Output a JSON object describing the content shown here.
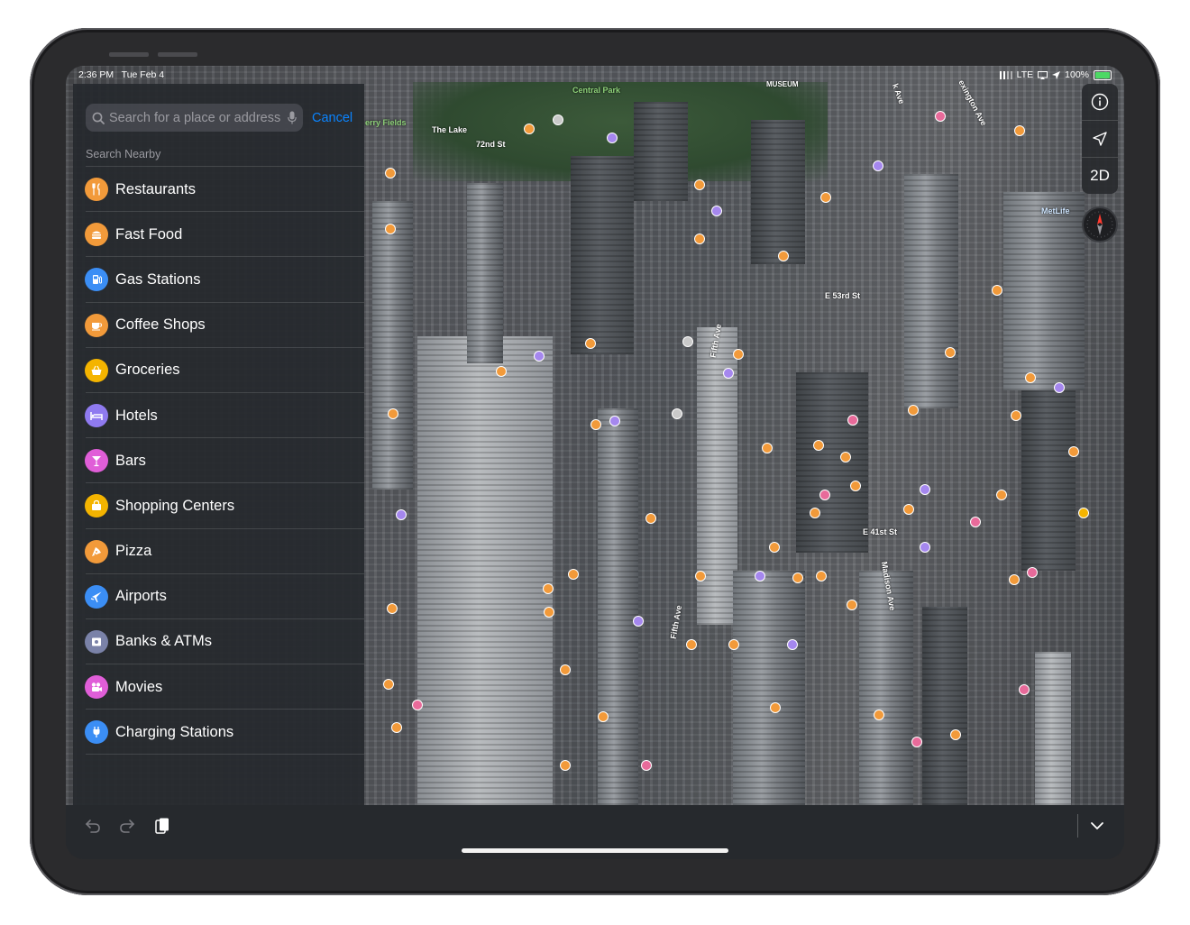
{
  "status_bar": {
    "time": "2:36 PM",
    "date": "Tue Feb 4",
    "network": "LTE",
    "battery": "100%"
  },
  "search": {
    "placeholder": "Search for a place or address",
    "cancel_label": "Cancel",
    "section_title": "Search Nearby"
  },
  "categories": [
    {
      "label": "Restaurants",
      "icon": "fork-knife-icon",
      "color": "#f29a3a"
    },
    {
      "label": "Fast Food",
      "icon": "burger-icon",
      "color": "#f29a3a"
    },
    {
      "label": "Gas Stations",
      "icon": "fuel-pump-icon",
      "color": "#3b8ef5"
    },
    {
      "label": "Coffee Shops",
      "icon": "coffee-cup-icon",
      "color": "#f29a3a"
    },
    {
      "label": "Groceries",
      "icon": "basket-icon",
      "color": "#f4b400"
    },
    {
      "label": "Hotels",
      "icon": "bed-icon",
      "color": "#8f7af0"
    },
    {
      "label": "Bars",
      "icon": "cocktail-icon",
      "color": "#e05ed8"
    },
    {
      "label": "Shopping Centers",
      "icon": "shopping-bag-icon",
      "color": "#f4b400"
    },
    {
      "label": "Pizza",
      "icon": "pizza-icon",
      "color": "#f29a3a"
    },
    {
      "label": "Airports",
      "icon": "airplane-icon",
      "color": "#3b8ef5"
    },
    {
      "label": "Banks & ATMs",
      "icon": "bank-icon",
      "color": "#7a82a8"
    },
    {
      "label": "Movies",
      "icon": "film-projector-icon",
      "color": "#e05ed8"
    },
    {
      "label": "Charging Stations",
      "icon": "ev-plug-icon",
      "color": "#3b8ef5"
    }
  ],
  "map_controls": {
    "view_mode_label": "2D"
  },
  "map_labels": {
    "central_park": "Central Park",
    "the_lake": "The Lake",
    "sheep_meadow": "erry Fields",
    "st_72": "72nd St",
    "museum": "MUSEUM",
    "k_ave": "k Ave",
    "lexington": "exington Ave",
    "metlife": "MetLife",
    "e53": "E 53rd St",
    "fifth_ave_1": "Fifth Ave",
    "fifth_ave_2": "Fifth Ave",
    "e41": "E 41st St",
    "madison": "Madison Ave"
  }
}
